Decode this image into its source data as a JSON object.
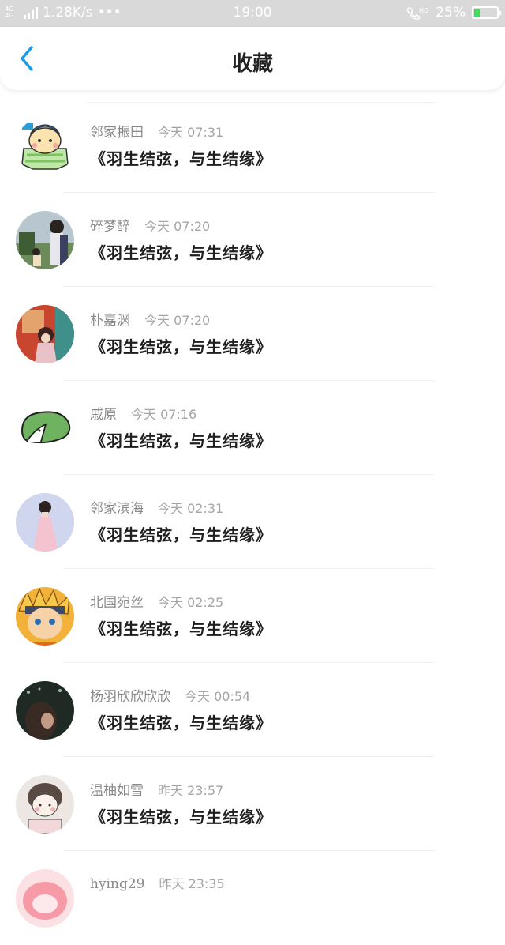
{
  "status_bar": {
    "network": "4G 4G",
    "speed": "1.28K/s",
    "dots": "•••",
    "time": "19:00",
    "hd": "HD",
    "battery_percent": "25%",
    "battery_level": 0.25,
    "battery_color": "#3ddc5a"
  },
  "nav": {
    "back_icon": "chevron-left-icon",
    "title": "收藏",
    "accent": "#1a9be6"
  },
  "items": [
    {
      "name": "邻家振田",
      "time": "今天 07:31",
      "content": "《羽生结弦，与生结缘》",
      "avatar": "cartoon-qing-figure"
    },
    {
      "name": "碎梦醉",
      "time": "今天 07:20",
      "content": "《羽生结弦，与生结缘》",
      "avatar": "photo-boy-outdoor"
    },
    {
      "name": "朴嘉渊",
      "time": "今天 07:20",
      "content": "《羽生结弦，与生结缘》",
      "avatar": "photo-girl-red-wall"
    },
    {
      "name": "戚原",
      "time": "今天 07:16",
      "content": "《羽生结弦，与生结缘》",
      "avatar": "green-blob-sketch"
    },
    {
      "name": "邻家滨海",
      "time": "今天 02:31",
      "content": "《羽生结弦，与生结缘》",
      "avatar": "photo-girl-pink-dress"
    },
    {
      "name": "北国宛丝",
      "time": "今天 02:25",
      "content": "《羽生结弦，与生结缘》",
      "avatar": "anime-naruto"
    },
    {
      "name": "杨羽欣欣欣欣",
      "time": "今天 00:54",
      "content": "《羽生结弦，与生结缘》",
      "avatar": "photo-dark-portrait"
    },
    {
      "name": "温柚如雪",
      "time": "昨天 23:57",
      "content": "《羽生结弦，与生结缘》",
      "avatar": "sketch-girl-drawing"
    },
    {
      "name": "hying29",
      "time": "昨天 23:35",
      "content": "",
      "avatar": "pink-cartoon"
    }
  ]
}
